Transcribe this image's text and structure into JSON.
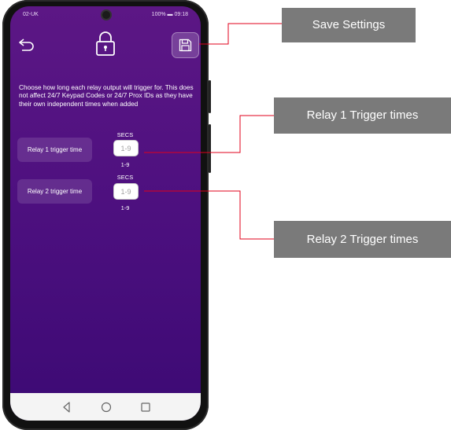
{
  "status_bar": {
    "carrier": "02-UK",
    "battery": "100%",
    "time": "09:18"
  },
  "description": "Choose how long each relay output will trigger for. This does not affect 24/7 Keypad Codes or 24/7 Prox IDs as they have their own independent times when added",
  "relays": [
    {
      "label": "Relay 1 trigger time",
      "unit": "SECS",
      "placeholder": "1-9",
      "range": "1-9"
    },
    {
      "label": "Relay 2 trigger time",
      "unit": "SECS",
      "placeholder": "1-9",
      "range": "1-9"
    }
  ],
  "callouts": {
    "save": "Save Settings",
    "relay1": "Relay 1 Trigger times",
    "relay2": "Relay 2 Trigger times"
  },
  "colors": {
    "screen_bg": "#4b0f7e",
    "callout_bg": "#7a7a7a",
    "connector_line": "#e0001b"
  },
  "icons": [
    "back-arrow-icon",
    "lock-icon",
    "save-disk-icon",
    "nav-back-icon",
    "nav-home-icon",
    "nav-recents-icon"
  ]
}
